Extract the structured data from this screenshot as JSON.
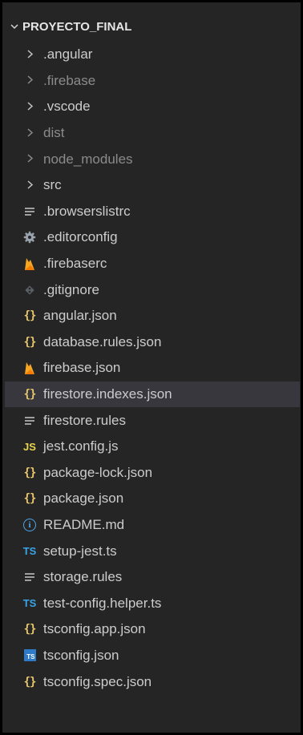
{
  "explorer": {
    "root": {
      "label": "PROYECTO_FINAL",
      "chevron": "✓"
    },
    "items": [
      {
        "label": ".angular",
        "kind": "folder",
        "icon": "chevron-right-icon",
        "dim": false
      },
      {
        "label": ".firebase",
        "kind": "folder",
        "icon": "chevron-right-icon",
        "dim": true
      },
      {
        "label": ".vscode",
        "kind": "folder",
        "icon": "chevron-right-icon",
        "dim": false
      },
      {
        "label": "dist",
        "kind": "folder",
        "icon": "chevron-right-icon",
        "dim": true
      },
      {
        "label": "node_modules",
        "kind": "folder",
        "icon": "chevron-right-icon",
        "dim": true
      },
      {
        "label": "src",
        "kind": "folder",
        "icon": "chevron-right-icon",
        "dim": false
      },
      {
        "label": ".browserslistrc",
        "kind": "file",
        "icon": "text-lines-icon",
        "dim": false
      },
      {
        "label": ".editorconfig",
        "kind": "file",
        "icon": "gear-icon",
        "dim": false
      },
      {
        "label": ".firebaserc",
        "kind": "file",
        "icon": "firebase-icon",
        "dim": false
      },
      {
        "label": ".gitignore",
        "kind": "file",
        "icon": "git-icon",
        "dim": false
      },
      {
        "label": "angular.json",
        "kind": "file",
        "icon": "json-braces-icon",
        "dim": false
      },
      {
        "label": "database.rules.json",
        "kind": "file",
        "icon": "json-braces-icon",
        "dim": false
      },
      {
        "label": "firebase.json",
        "kind": "file",
        "icon": "firebase-icon",
        "dim": false
      },
      {
        "label": "firestore.indexes.json",
        "kind": "file",
        "icon": "json-braces-icon",
        "dim": false,
        "selected": true
      },
      {
        "label": "firestore.rules",
        "kind": "file",
        "icon": "text-lines-icon",
        "dim": false
      },
      {
        "label": "jest.config.js",
        "kind": "file",
        "icon": "javascript-icon",
        "dim": false
      },
      {
        "label": "package-lock.json",
        "kind": "file",
        "icon": "json-braces-icon",
        "dim": false
      },
      {
        "label": "package.json",
        "kind": "file",
        "icon": "json-braces-icon",
        "dim": false
      },
      {
        "label": "README.md",
        "kind": "file",
        "icon": "info-icon",
        "dim": false
      },
      {
        "label": "setup-jest.ts",
        "kind": "file",
        "icon": "typescript-icon",
        "dim": false
      },
      {
        "label": "storage.rules",
        "kind": "file",
        "icon": "text-lines-icon",
        "dim": false
      },
      {
        "label": "test-config.helper.ts",
        "kind": "file",
        "icon": "typescript-icon",
        "dim": false
      },
      {
        "label": "tsconfig.app.json",
        "kind": "file",
        "icon": "json-braces-icon",
        "dim": false
      },
      {
        "label": "tsconfig.json",
        "kind": "file",
        "icon": "tsconfig-icon",
        "dim": false
      },
      {
        "label": "tsconfig.spec.json",
        "kind": "file",
        "icon": "json-braces-icon",
        "dim": false
      }
    ]
  },
  "colors": {
    "background": "#252526",
    "selected_row": "#37373d",
    "json_braces": "#e8c86a",
    "typescript": "#3aa4e8",
    "javascript": "#e8d44d",
    "firebase": "#f5a623"
  }
}
